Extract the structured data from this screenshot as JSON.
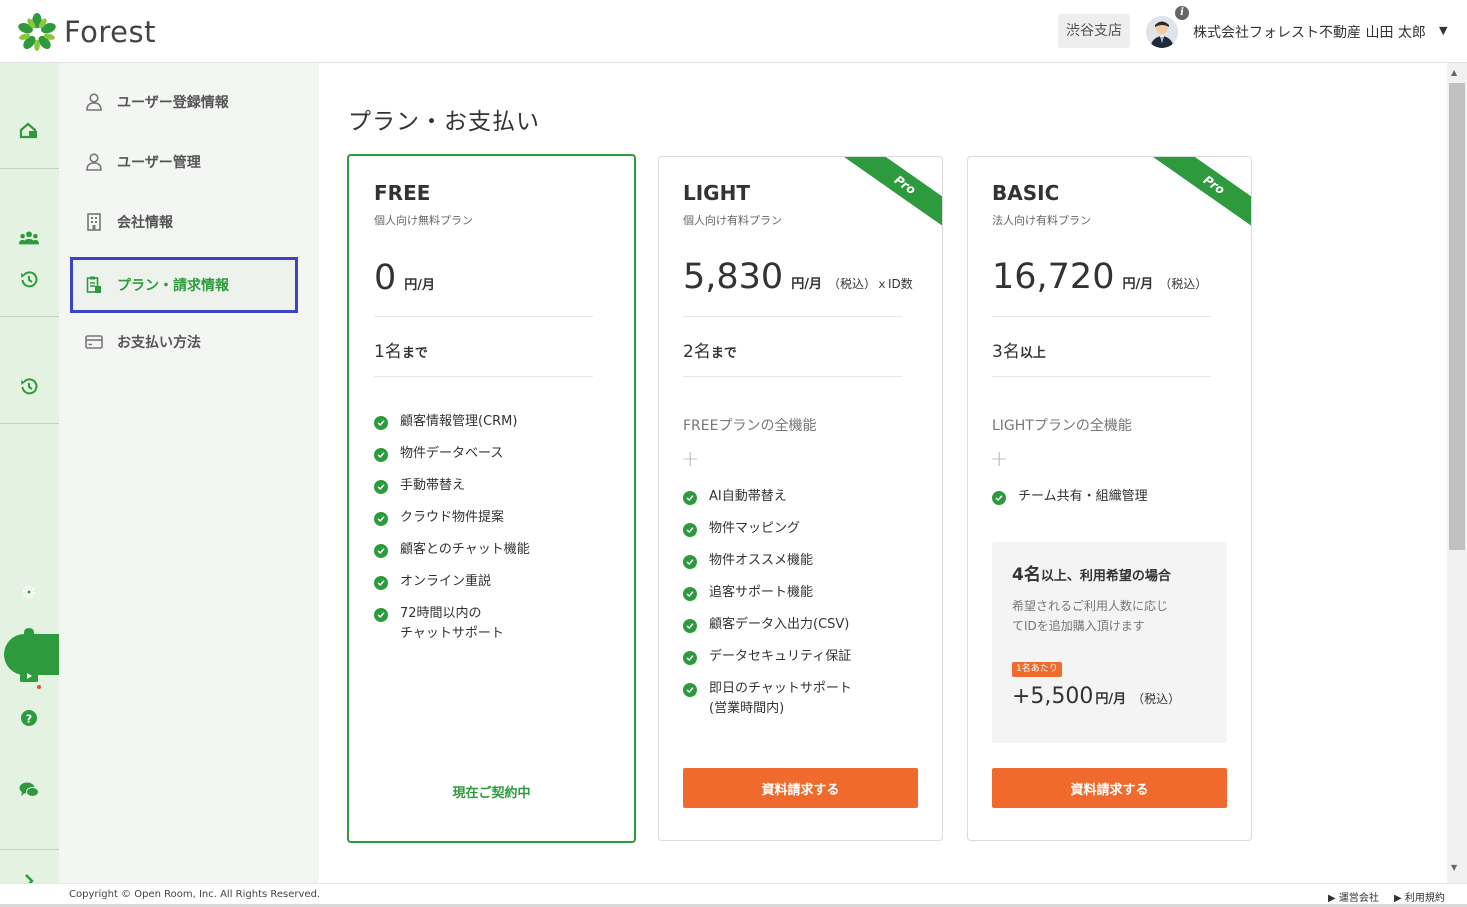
{
  "header": {
    "logo_text": "Forest",
    "branch": "渋谷支店",
    "user_name": "株式会社フォレスト不動産 山田 太郎",
    "caret": "▼",
    "info_glyph": "i"
  },
  "colors": {
    "brand_green": "#2e9a3e",
    "cta_orange": "#ef6a2c",
    "selection_outline": "#3a44c4",
    "rail_bg": "#e3f2e1"
  },
  "rail": {
    "icons": [
      "home-icon",
      "group-icon",
      "history-icon",
      "history-icon",
      "gear-icon",
      "bell-icon",
      "video-icon",
      "help-icon",
      "chat-icon",
      "expand-icon"
    ]
  },
  "menu": {
    "items": [
      {
        "label": "ユーザー登録情報",
        "icon": "user-icon"
      },
      {
        "label": "ユーザー管理",
        "icon": "user-icon"
      },
      {
        "label": "会社情報",
        "icon": "building-icon"
      },
      {
        "label": "プラン・請求情報",
        "icon": "plan-icon"
      },
      {
        "label": "お支払い方法",
        "icon": "card-icon"
      }
    ]
  },
  "page": {
    "title": "プラン・お支払い"
  },
  "plans": [
    {
      "name": "FREE",
      "sub": "個人向け無料プラン",
      "price": "0",
      "unit": "円/月",
      "tax": "",
      "seats_num": "1名",
      "seats_suffix": "まで",
      "features": [
        "顧客情報管理(CRM)",
        "物件データベース",
        "手動帯替え",
        "クラウド物件提案",
        "顧客とのチャット機能",
        "オンライン重説",
        "72時間以内の\nチャットサポート"
      ],
      "status": "現在ご契約中"
    },
    {
      "name": "LIGHT",
      "sub": "個人向け有料プラン",
      "price": "5,830",
      "unit": "円/月",
      "tax": "（税込）ｘID数",
      "seats_num": "2名",
      "seats_suffix": "まで",
      "ribbon": "Pro",
      "intro": "FREEプランの全機能",
      "plus": "+",
      "features": [
        "AI自動帯替え",
        "物件マッピング",
        "物件オススメ機能",
        "追客サポート機能",
        "顧客データ入出力(CSV)",
        "データセキュリティ保証",
        "即日のチャットサポート\n(営業時間内)"
      ],
      "button": "資料請求する"
    },
    {
      "name": "BASIC",
      "sub": "法人向け有料プラン",
      "price": "16,720",
      "unit": "円/月",
      "tax": "（税込）",
      "seats_num": "3名",
      "seats_suffix": "以上",
      "ribbon": "Pro",
      "intro": "LIGHTプランの全機能",
      "plus": "+",
      "features": [
        "チーム共有・組織管理"
      ],
      "extra": {
        "title_num": "4名",
        "title_rest": "以上、利用希望の場合",
        "desc": "希望されるご利用人数に応じ\nてIDを追加購入頂けます",
        "badge": "1名あたり",
        "price": "+5,500",
        "unit": "円/月",
        "tax": "（税込）"
      },
      "button": "資料請求する"
    }
  ],
  "footer": {
    "copyright": "Copyright © Open Room, Inc. All Rights Reserved.",
    "links": [
      "▶ 運営会社",
      "▶ 利用規約"
    ]
  }
}
